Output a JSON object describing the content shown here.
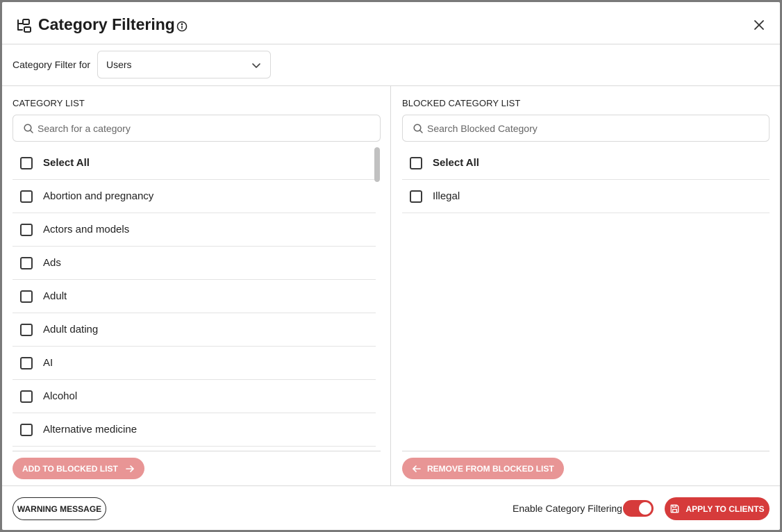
{
  "header": {
    "title": "Category Filtering"
  },
  "filter_bar": {
    "label": "Category Filter for",
    "selected": "Users"
  },
  "category_list": {
    "title": "CATEGORY LIST",
    "search_placeholder": "Search for a category",
    "select_all": "Select All",
    "items": [
      "Abortion and pregnancy",
      "Actors and models",
      "Ads",
      "Adult",
      "Adult dating",
      "AI",
      "Alcohol",
      "Alternative medicine"
    ],
    "action_label": "ADD TO BLOCKED LIST"
  },
  "blocked_list": {
    "title": "BLOCKED CATEGORY LIST",
    "search_placeholder": "Search Blocked Category",
    "select_all": "Select All",
    "items": [
      "Illegal"
    ],
    "action_label": "REMOVE FROM BLOCKED LIST"
  },
  "footer": {
    "warning_label": "WARNING MESSAGE",
    "toggle_label": "Enable Category Filtering",
    "toggle_on": true,
    "apply_label": "APPLY TO CLIENTS"
  },
  "colors": {
    "accent": "#d63b3b",
    "accent_disabled": "#e89595",
    "border": "#d9d9d9"
  }
}
